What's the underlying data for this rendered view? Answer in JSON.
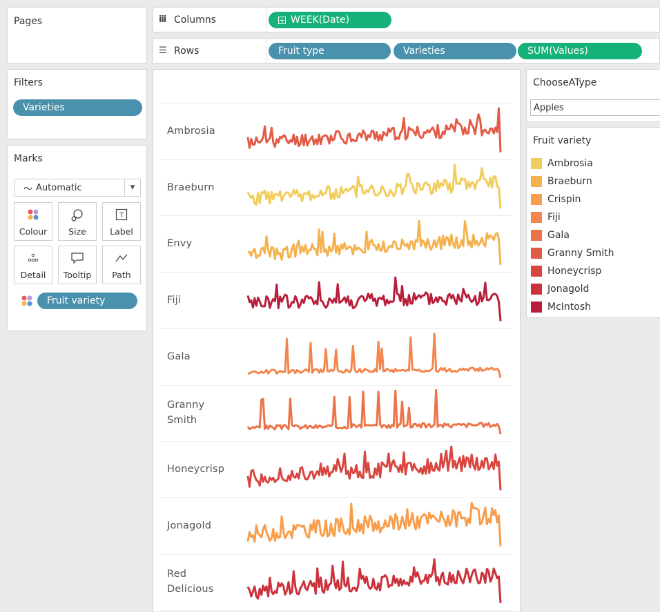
{
  "pages": {
    "title": "Pages"
  },
  "shelves": {
    "columns": {
      "label": "Columns",
      "icon": "columns-icon",
      "pills": [
        {
          "text": "WEEK(Date)",
          "color": "#16b179",
          "icon": "plus-box-icon"
        }
      ]
    },
    "rows": {
      "label": "Rows",
      "icon": "rows-icon",
      "pills": [
        {
          "text": "Fruit type",
          "color": "#4a91ad"
        },
        {
          "text": "Varieties",
          "color": "#4a91ad"
        },
        {
          "text": "SUM(Values)",
          "color": "#16b179"
        }
      ]
    }
  },
  "filters": {
    "title": "Filters",
    "pills": [
      {
        "text": "Varieties",
        "color": "#4a91ad"
      }
    ]
  },
  "marks": {
    "title": "Marks",
    "mark_type": "Automatic",
    "mark_type_icon": "line-mark-icon",
    "buttons": [
      {
        "label": "Colour",
        "icon": "colour-dots-icon"
      },
      {
        "label": "Size",
        "icon": "size-icon"
      },
      {
        "label": "Label",
        "icon": "label-icon"
      },
      {
        "label": "Detail",
        "icon": "detail-icon"
      },
      {
        "label": "Tooltip",
        "icon": "tooltip-icon"
      },
      {
        "label": "Path",
        "icon": "path-icon"
      }
    ],
    "colour_pill": {
      "text": "Fruit variety",
      "color": "#4a91ad"
    }
  },
  "parameter": {
    "title": "ChooseAType",
    "value": "Apples"
  },
  "legend": {
    "title": "Fruit variety",
    "items": [
      {
        "label": "Ambrosia",
        "color": "#f0cd5c"
      },
      {
        "label": "Braeburn",
        "color": "#f4b24f"
      },
      {
        "label": "Crispin",
        "color": "#f79d4b"
      },
      {
        "label": "Fiji",
        "color": "#f3864c"
      },
      {
        "label": "Gala",
        "color": "#ec7347"
      },
      {
        "label": "Granny Smith",
        "color": "#e35b46"
      },
      {
        "label": "Honeycrisp",
        "color": "#d8463f"
      },
      {
        "label": "Jonagold",
        "color": "#cb323c"
      },
      {
        "label": "McIntosh",
        "color": "#b81f3a"
      }
    ]
  },
  "chart_data": {
    "type": "line",
    "x": "WEEK(Date)",
    "y": "SUM(Values)",
    "rows": [
      {
        "label": "Ambrosia",
        "color": "#e35b46",
        "seed": 11,
        "profile": "trend",
        "values": []
      },
      {
        "label": "Braeburn",
        "color": "#f0cd5c",
        "seed": 23,
        "profile": "trend",
        "values": []
      },
      {
        "label": "Envy",
        "color": "#f4b24f",
        "seed": 37,
        "profile": "trend",
        "values": []
      },
      {
        "label": "Fiji",
        "color": "#b81f3a",
        "seed": 41,
        "profile": "flat",
        "values": []
      },
      {
        "label": "Gala",
        "color": "#f3864c",
        "seed": 53,
        "profile": "spiky",
        "values": []
      },
      {
        "label": "Granny\nSmith",
        "color": "#ec7347",
        "seed": 67,
        "profile": "spiky",
        "values": []
      },
      {
        "label": "Honeycrisp",
        "color": "#d8463f",
        "seed": 71,
        "profile": "trend",
        "values": []
      },
      {
        "label": "Jonagold",
        "color": "#f79d4b",
        "seed": 83,
        "profile": "trend",
        "values": []
      },
      {
        "label": "Red\nDelicious",
        "color": "#cb323c",
        "seed": 97,
        "profile": "trend",
        "values": []
      }
    ]
  }
}
